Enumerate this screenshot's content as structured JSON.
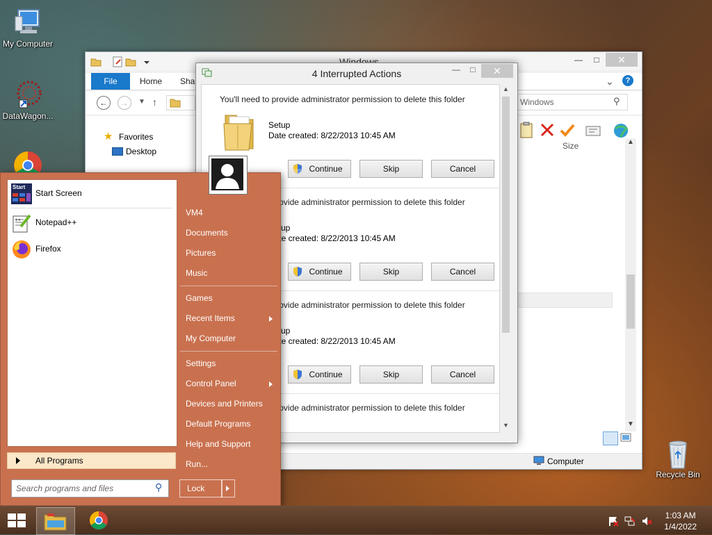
{
  "desktop": {
    "icons": [
      {
        "label": "My Computer"
      },
      {
        "label": "DataWagon..."
      },
      {
        "label": "Recycle Bin"
      }
    ]
  },
  "explorer": {
    "title": "Windows",
    "tabs": {
      "file": "File",
      "home": "Home",
      "share": "Shar"
    },
    "search_placeholder": "Windows",
    "nav": {
      "favorites": "Favorites",
      "desktop": "Desktop"
    },
    "column_size": "Size",
    "status_location": "Computer"
  },
  "dialog": {
    "title": "4 Interrupted Actions",
    "items": [
      {
        "message": "You'll need to provide administrator permission to delete this folder",
        "name": "Setup",
        "date": "Date created: 8/22/2013 10:45 AM"
      },
      {
        "message": "You'll need to provide administrator permission to delete this folder",
        "name": "Setup",
        "date": "Date created: 8/22/2013 10:45 AM"
      },
      {
        "message": "You'll need to provide administrator permission to delete this folder",
        "name": "Setup",
        "date": "Date created: 8/22/2013 10:45 AM"
      },
      {
        "message": "You'll need to provide administrator permission to delete this folder"
      }
    ],
    "buttons": {
      "continue": "Continue",
      "skip": "Skip",
      "cancel": "Cancel"
    }
  },
  "start_menu": {
    "programs": [
      {
        "label": "Start Screen"
      },
      {
        "label": "Notepad++"
      },
      {
        "label": "Firefox"
      }
    ],
    "all_programs": "All Programs",
    "search_placeholder": "Search programs and files",
    "right": {
      "vm4": "VM4",
      "documents": "Documents",
      "pictures": "Pictures",
      "music": "Music",
      "games": "Games",
      "recent_items": "Recent Items",
      "my_computer": "My Computer",
      "settings": "Settings",
      "control_panel": "Control Panel",
      "devices_printers": "Devices and Printers",
      "default_programs": "Default Programs",
      "help_support": "Help and Support",
      "run": "Run..."
    },
    "lock": "Lock",
    "start_tile_text": "Start"
  },
  "taskbar": {
    "time": "1:03 AM",
    "date": "1/4/2022"
  },
  "colors": {
    "start_menu_bg": "#c9714f",
    "file_tab": "#1979ca",
    "close_button": "#c7c7c7"
  }
}
